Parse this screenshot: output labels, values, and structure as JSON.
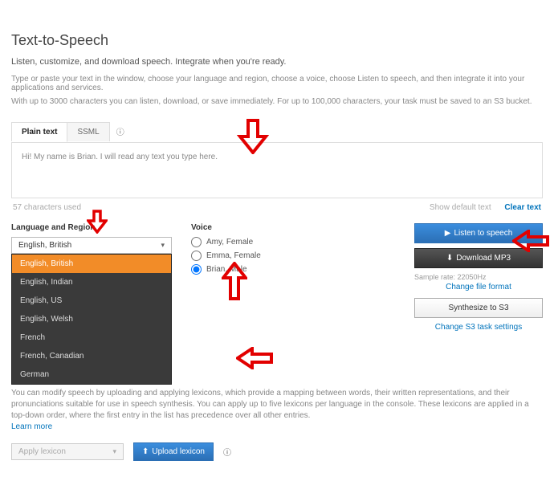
{
  "header": {
    "title": "Text-to-Speech",
    "subtitle": "Listen, customize, and download speech. Integrate when you're ready.",
    "desc1": "Type or paste your text in the window, choose your language and region, choose a voice, choose Listen to speech, and then integrate it into your applications and services.",
    "desc2": "With up to 3000 characters you can listen, download, or save immediately. For up to 100,000 characters, your task must be saved to an S3 bucket."
  },
  "tabs": {
    "plain": "Plain text",
    "ssml": "SSML"
  },
  "textarea": {
    "value": "Hi! My name is Brian. I will read any text you type here.",
    "chars_label": "57 characters used",
    "show_default": "Show default text",
    "clear": "Clear text"
  },
  "language": {
    "label": "Language and Region",
    "selected": "English, British",
    "options": [
      "English, British",
      "English, Indian",
      "English, US",
      "English, Welsh",
      "French",
      "French, Canadian",
      "German"
    ]
  },
  "voice": {
    "label": "Voice",
    "options": [
      {
        "label": "Amy, Female",
        "checked": false
      },
      {
        "label": "Emma, Female",
        "checked": false
      },
      {
        "label": "Brian, Male",
        "checked": true
      }
    ]
  },
  "actions": {
    "listen": "Listen to speech",
    "download": "Download MP3",
    "sample_rate": "Sample rate: 22050Hz",
    "change_format": "Change file format",
    "synthesize": "Synthesize to S3",
    "change_s3": "Change S3 task settings"
  },
  "lexicon": {
    "desc": "You can modify speech by uploading and applying lexicons, which provide a mapping between words, their written representations, and their pronunciations suitable for use in speech synthesis. You can apply up to five lexicons per language in the console. These lexicons are applied in a top-down order, where the first entry in the list has precedence over all other entries.",
    "learn": "Learn more",
    "apply_placeholder": "Apply lexicon",
    "upload": "Upload lexicon"
  }
}
